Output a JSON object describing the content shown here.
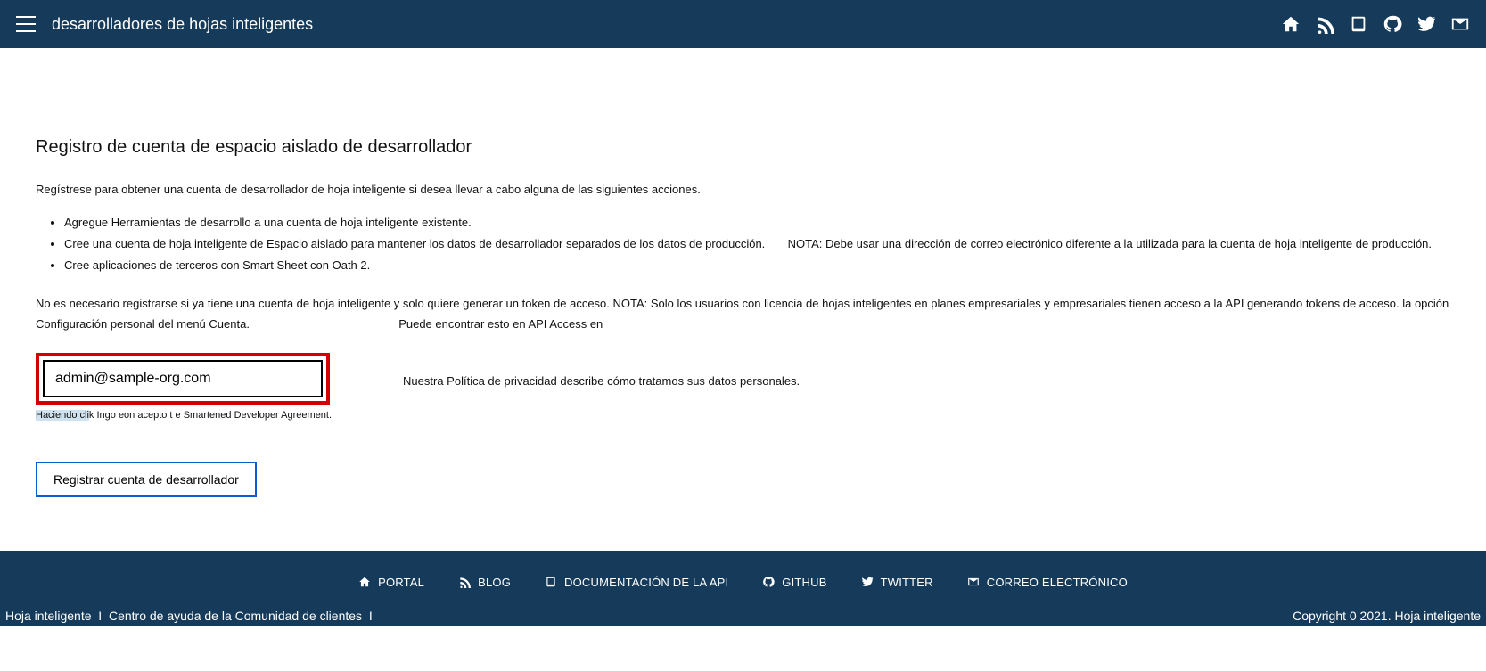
{
  "header": {
    "site_title": "desarrolladores de hojas inteligentes"
  },
  "page": {
    "title": "Registro de cuenta de espacio aislado de desarrollador",
    "intro": "Regístrese para obtener una cuenta de desarrollador de hoja inteligente si desea llevar a cabo alguna de las siguientes acciones.",
    "bullet1": "Agregue Herramientas de desarrollo a una cuenta de hoja inteligente existente.",
    "bullet2a": "Cree una cuenta de hoja inteligente de Espacio aislado para mantener los datos de desarrollador separados de los datos de producción.",
    "bullet2b": "NOTA: Debe usar una dirección de correo electrónico diferente a la utilizada para la cuenta de hoja inteligente de producción.",
    "bullet3": "Cree aplicaciones de terceros con Smart Sheet con Oath 2.",
    "no_reg_prefix": "No es necesario registrarse si ya tiene una cuenta de hoja inteligente y solo quiere generar un token de acceso. NOTA: Solo los usuarios con licencia de hojas inteligentes en planes empresariales y empresariales tienen acceso a la API generando tokens de acceso. la opción Configuración personal del menú Cuenta.",
    "no_reg_suffix": "Puede encontrar esto en API Access en",
    "email_value": "admin@sample-org.com",
    "agree_hl": "Haciendo cli",
    "agree_text": "k Ingo eon acepto t e Smartened Developer Agreement.",
    "privacy": "Nuestra Política de privacidad describe cómo tratamos sus datos personales.",
    "register_btn": "Registrar cuenta de desarrollador"
  },
  "footer": {
    "nav": {
      "portal": "PORTAL",
      "blog": "BLOG",
      "api_docs": "DOCUMENTACIÓN DE LA API",
      "github": "GITHUB",
      "twitter": "TWITTER",
      "email": "CORREO ELECTRÓNICO"
    },
    "legal_left1": "Hoja inteligente",
    "legal_left2": "Centro de ayuda de la Comunidad de clientes",
    "copyright": "Copyright 0 2021. Hoja inteligente"
  }
}
